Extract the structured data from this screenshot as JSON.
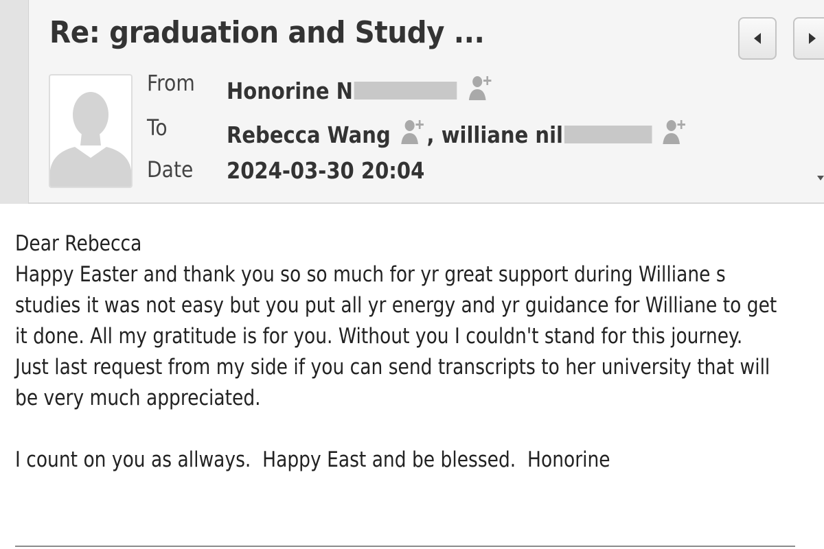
{
  "message": {
    "subject": "Re: graduation and Study ...",
    "from_label": "From",
    "from_name": "Honorine N",
    "to_label": "To",
    "to_name_1": "Rebecca Wang",
    "to_separator": ", ",
    "to_name_2": "williane nil",
    "date_label": "Date",
    "date_value": "2024-03-30 20:04"
  },
  "body": {
    "text": "Dear Rebecca\nHappy Easter and thank you so so much for yr great support during Williane s\nstudies it was not easy but you put all yr energy and yr guidance for Williane to get\nit done. All my gratitude is for you. Without you I couldn't stand for this journey.\nJust last request from my side if you can send transcripts to her university that will\nbe very much appreciated.\n\nI count on you as allways.  Happy East and be blessed.  Honorine"
  },
  "icons": {
    "add_contact": "add-contact-icon",
    "prev": "chevron-left-icon",
    "next": "chevron-right-icon",
    "more": "caret-down-icon",
    "avatar": "default-avatar-icon"
  },
  "colors": {
    "header_bg": "#f5f5f5",
    "icon_gray": "#a9a9a9",
    "redaction": "#c8c8c8"
  }
}
